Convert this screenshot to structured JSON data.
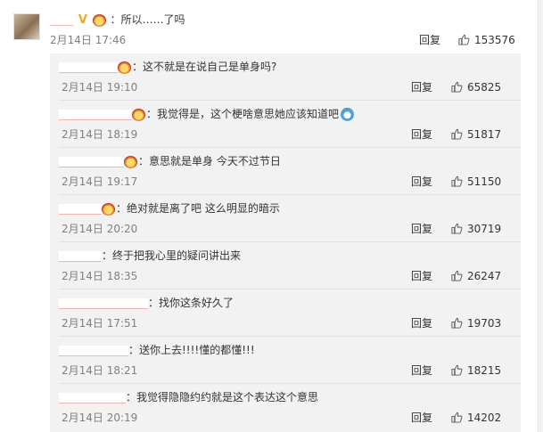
{
  "main_comment": {
    "text": "：所以……了吗",
    "time": "2月14日 17:46",
    "reply_label": "回复",
    "likes": "153576"
  },
  "replies": [
    {
      "text": "：这不就是在说自己是单身吗?",
      "time": "2月14日 19:10",
      "reply_label": "回复",
      "likes": "65825",
      "redact_w": 66,
      "emo": true
    },
    {
      "text": "：我觉得是，这个梗啥意思她应该知道吧",
      "time": "2月14日 18:19",
      "reply_label": "回复",
      "likes": "51817",
      "redact_w": 82,
      "emo": true,
      "emo_end": true
    },
    {
      "text": "：意思就是单身 今天不过节日",
      "time": "2月14日 19:17",
      "reply_label": "回复",
      "likes": "51150",
      "redact_w": 73,
      "emo": true
    },
    {
      "text": "：绝对就是离了吧 这么明显的暗示",
      "time": "2月14日 20:20",
      "reply_label": "回复",
      "likes": "30719",
      "redact_w": 48,
      "emo": true
    },
    {
      "text": "：终于把我心里的疑问讲出来",
      "time": "2月14日 18:35",
      "reply_label": "回复",
      "likes": "26247",
      "redact_w": 48,
      "emo": false
    },
    {
      "text": "：找你这条好久了",
      "time": "2月14日 17:51",
      "reply_label": "回复",
      "likes": "19703",
      "redact_w": 100,
      "emo": false
    },
    {
      "text": "：送你上去!!!!懂的都懂!!!",
      "time": "2月14日 18:21",
      "reply_label": "回复",
      "likes": "18215",
      "redact_w": 78,
      "emo": false
    },
    {
      "text": "：我觉得隐隐约约就是这个表达这个意思",
      "time": "2月14日 20:19",
      "reply_label": "回复",
      "likes": "14202",
      "redact_w": 75,
      "emo": false
    }
  ]
}
